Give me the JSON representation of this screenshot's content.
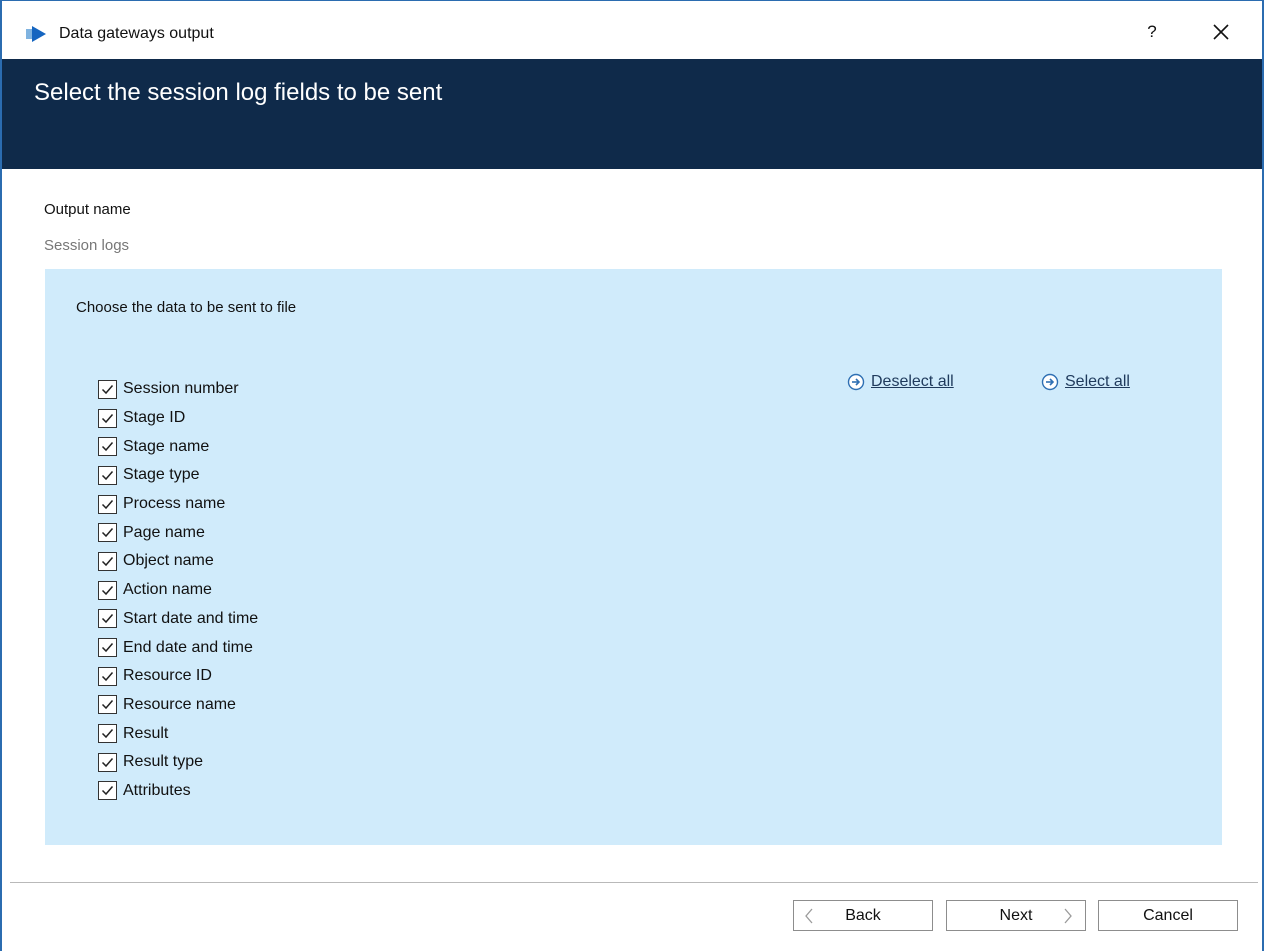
{
  "window": {
    "title": "Data gateways output",
    "help_label": "?",
    "accent_color": "#0f2a4a"
  },
  "header": {
    "heading": "Select the session log fields to be sent"
  },
  "output": {
    "label": "Output name",
    "value": "Session logs"
  },
  "panel": {
    "heading": "Choose the data to be sent to file",
    "background": "#d0ebfb",
    "deselect_all": "Deselect all",
    "select_all": "Select all",
    "fields": [
      {
        "label": "Session number",
        "checked": true
      },
      {
        "label": "Stage ID",
        "checked": true
      },
      {
        "label": "Stage name",
        "checked": true
      },
      {
        "label": "Stage type",
        "checked": true
      },
      {
        "label": "Process name",
        "checked": true
      },
      {
        "label": "Page name",
        "checked": true
      },
      {
        "label": "Object name",
        "checked": true
      },
      {
        "label": "Action name",
        "checked": true
      },
      {
        "label": "Start date and time",
        "checked": true
      },
      {
        "label": "End date and time",
        "checked": true
      },
      {
        "label": "Resource ID",
        "checked": true
      },
      {
        "label": "Resource name",
        "checked": true
      },
      {
        "label": "Result",
        "checked": true
      },
      {
        "label": "Result type",
        "checked": true
      },
      {
        "label": "Attributes",
        "checked": true
      }
    ]
  },
  "footer": {
    "back": "Back",
    "next": "Next",
    "cancel": "Cancel"
  },
  "icons": {
    "app": "blue-prism-logo-icon",
    "close": "close-icon",
    "link_arrow": "circle-arrow-right-icon",
    "back_chevron": "chevron-left-icon",
    "next_chevron": "chevron-right-icon"
  }
}
